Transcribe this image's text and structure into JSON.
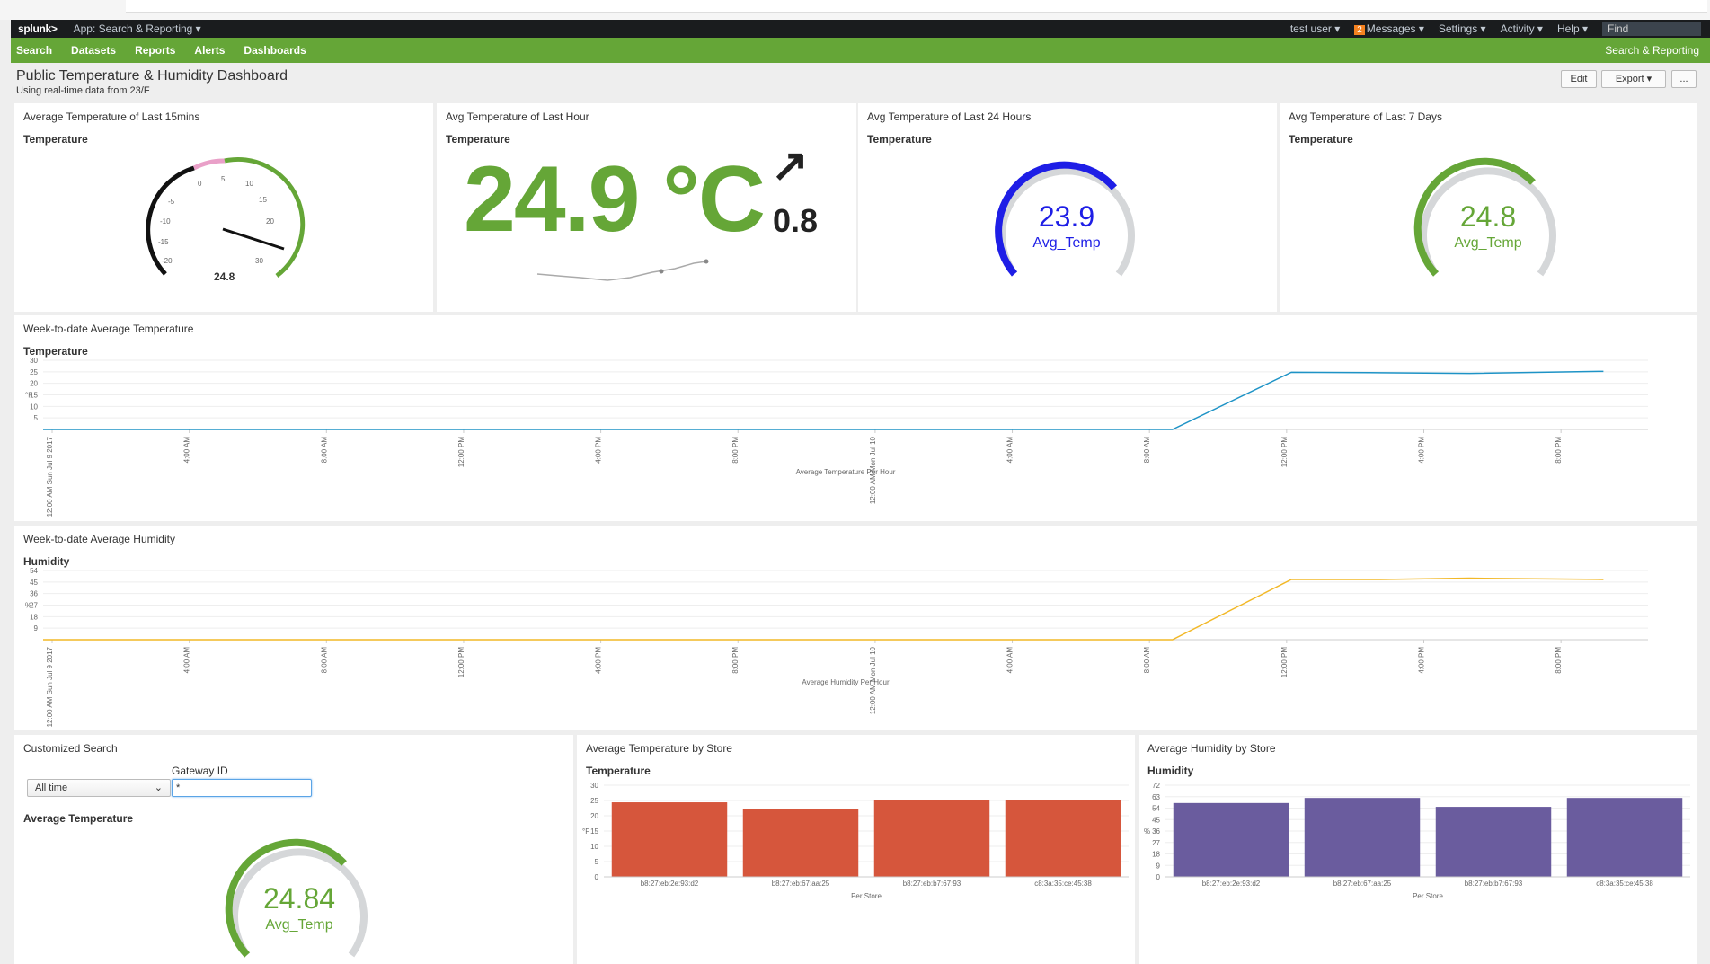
{
  "appbar": {
    "logo": "splunk>",
    "app_label": "App: Search & Reporting ▾",
    "user": "test user ▾",
    "messages_count": "2",
    "messages": "Messages ▾",
    "settings": "Settings ▾",
    "activity": "Activity ▾",
    "help": "Help ▾",
    "find": "Find"
  },
  "nav": {
    "items": [
      "Search",
      "Datasets",
      "Reports",
      "Alerts",
      "Dashboards"
    ],
    "app_name": "Search & Reporting"
  },
  "dashboard": {
    "title": "Public Temperature & Humidity Dashboard",
    "subtitle": "Using real-time data from 23/F",
    "edit": "Edit",
    "export": "Export ▾",
    "more": "..."
  },
  "panels": {
    "p15m": {
      "title": "Average Temperature of Last 15mins",
      "viz": "Temperature",
      "value": "24.8",
      "ticks": [
        "-20",
        "-15",
        "-10",
        "-5",
        "0",
        "5",
        "10",
        "15",
        "20",
        "30"
      ]
    },
    "p1h": {
      "title": "Avg Temperature of Last Hour",
      "viz": "Temperature",
      "value": "24.9 °C",
      "delta": "0.8",
      "delta_arrow": "↗"
    },
    "p24h": {
      "title": "Avg Temperature of Last 24 Hours",
      "viz": "Temperature",
      "value": "23.9",
      "label": "Avg_Temp"
    },
    "p7d": {
      "title": "Avg Temperature of Last 7 Days",
      "viz": "Temperature",
      "value": "24.8",
      "label": "Avg_Temp"
    },
    "weekTemp": {
      "title": "Week-to-date Average Temperature",
      "viz": "Temperature"
    },
    "weekHum": {
      "title": "Week-to-date Average Humidity",
      "viz": "Humidity"
    },
    "custom": {
      "title": "Customized Search",
      "time_select": "All time",
      "gateway_label": "Gateway ID",
      "gateway_value": "*",
      "viz": "Average Temperature",
      "value": "24.84",
      "label": "Avg_Temp"
    },
    "storeTemp": {
      "title": "Average Temperature by Store",
      "viz": "Temperature"
    },
    "storeHum": {
      "title": "Average Humidity by Store",
      "viz": "Humidity"
    }
  },
  "colors": {
    "splunk_green": "#65a637",
    "blue": "#1e1ee6",
    "line_blue": "#1e93c6",
    "line_yellow": "#f2b827",
    "bar_orange": "#d6563c",
    "bar_purple": "#6a5c9e"
  },
  "chart_data": [
    {
      "type": "line",
      "title": "Week-to-date Average Temperature",
      "ylabel": "°F",
      "xlabel": "Average Temperature Per Hour",
      "ylim": [
        0,
        30
      ],
      "yticks": [
        5,
        10,
        15,
        20,
        25,
        30
      ],
      "xticks": [
        "12:00 AM Sun Jul 9 2017",
        "4:00 AM",
        "8:00 AM",
        "12:00 PM",
        "4:00 PM",
        "8:00 PM",
        "12:00 AM Mon Jul 10",
        "4:00 AM",
        "8:00 AM",
        "12:00 PM",
        "4:00 PM",
        "8:00 PM"
      ],
      "x": [
        0,
        36,
        37,
        38,
        42,
        45,
        48,
        52.5
      ],
      "series": [
        {
          "values": [
            0,
            0,
            0,
            0,
            24.8,
            24.6,
            24.3,
            25.2
          ]
        }
      ]
    },
    {
      "type": "line",
      "title": "Week-to-date Average Humidity",
      "ylabel": "%",
      "xlabel": "Average Humidity Per Hour",
      "ylim": [
        0,
        54
      ],
      "yticks": [
        9,
        18,
        27,
        36,
        45,
        54
      ],
      "xticks": [
        "12:00 AM Sun Jul 9 2017",
        "4:00 AM",
        "8:00 AM",
        "12:00 PM",
        "4:00 PM",
        "8:00 PM",
        "12:00 AM Mon Jul 10",
        "4:00 AM",
        "8:00 AM",
        "12:00 PM",
        "4:00 PM",
        "8:00 PM"
      ],
      "x": [
        0,
        36,
        37,
        38,
        42,
        45,
        48,
        52.5
      ],
      "series": [
        {
          "values": [
            0,
            0,
            0,
            0,
            47,
            47,
            48,
            47
          ]
        }
      ]
    },
    {
      "type": "bar",
      "title": "Average Temperature by Store",
      "xlabel": "Per Store",
      "ylabel": "°F",
      "ylim": [
        0,
        30
      ],
      "yticks": [
        0,
        5,
        10,
        15,
        20,
        25,
        30
      ],
      "categories": [
        "b8:27:eb:2e:93:d2",
        "b8:27:eb:67:aa:25",
        "b8:27:eb:b7:67:93",
        "c8:3a:35:ce:45:38"
      ],
      "values": [
        24.4,
        22.2,
        25,
        25
      ]
    },
    {
      "type": "bar",
      "title": "Average Humidity by Store",
      "xlabel": "Per Store",
      "ylabel": "%",
      "ylim": [
        0,
        72
      ],
      "yticks": [
        0,
        9,
        18,
        27,
        36,
        45,
        54,
        63,
        72
      ],
      "categories": [
        "b8:27:eb:2e:93:d2",
        "b8:27:eb:67:aa:25",
        "b8:27:eb:b7:67:93",
        "c8:3a:35:ce:45:38"
      ],
      "values": [
        58,
        62,
        55,
        62
      ]
    }
  ]
}
